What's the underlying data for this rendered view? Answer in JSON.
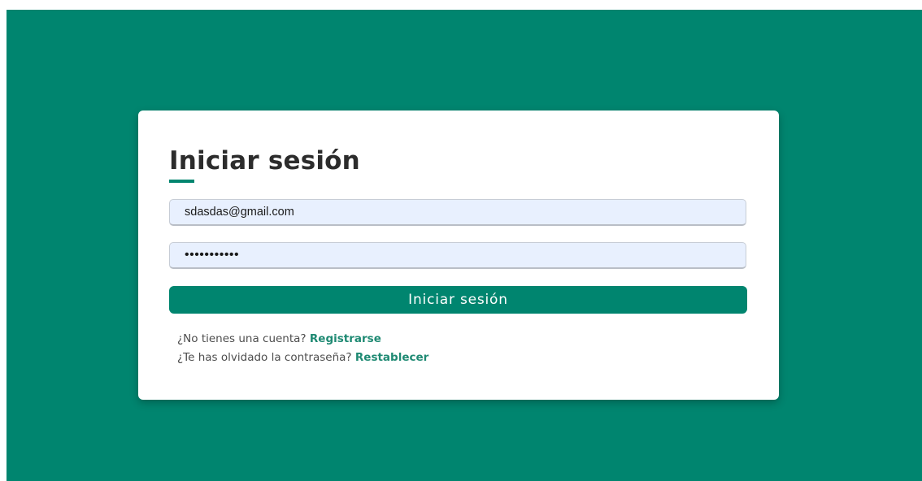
{
  "login": {
    "title": "Iniciar sesión",
    "email": {
      "value": "sdasdas@gmail.com"
    },
    "password": {
      "value": "•••••••••••"
    },
    "submit_label": "Iniciar sesión",
    "register_prompt": "¿No tienes una cuenta?",
    "register_link": "Registrarse",
    "reset_prompt": "¿Te has olvidado la contraseña?",
    "reset_link": "Restablecer"
  },
  "colors": {
    "brand": "#00856f",
    "card": "#ffffff",
    "input_bg": "#e8f0fe"
  }
}
